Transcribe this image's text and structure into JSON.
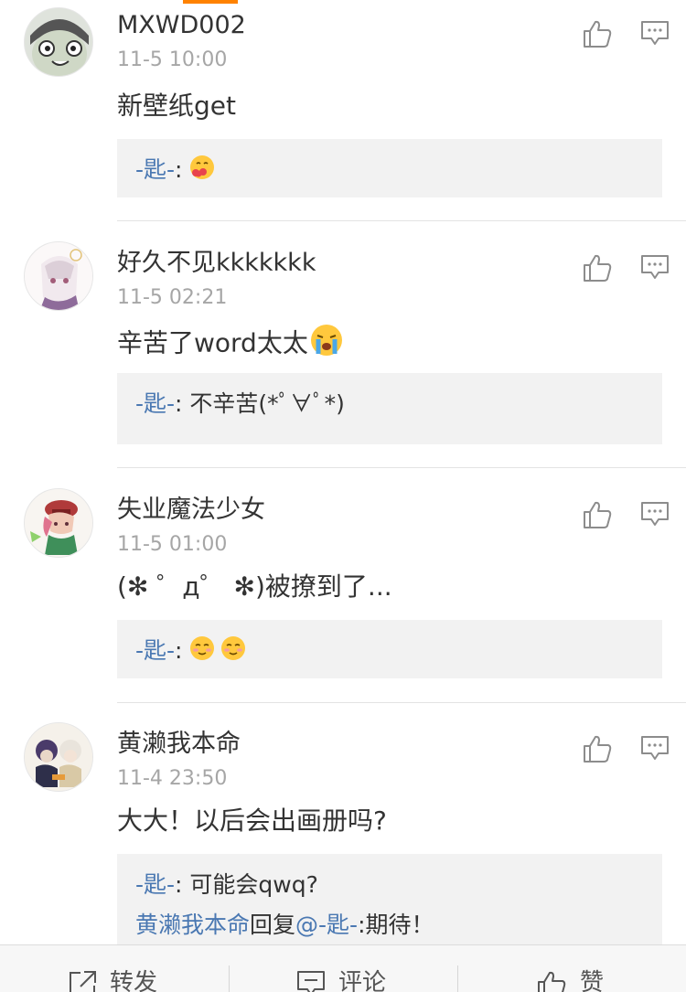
{
  "comments": [
    {
      "username": "MXWD002",
      "time": "11-5 10:00",
      "text": "新壁纸get",
      "text_emoji": "",
      "reply": {
        "author": "-匙-",
        "sep": ": ",
        "text": "",
        "emoji": [
          "tongue-kiss-emoji"
        ]
      }
    },
    {
      "username": "好久不见kkkkkkk",
      "time": "11-5 02:21",
      "text": "辛苦了word太太",
      "text_emoji": "crying-emoji",
      "reply": {
        "author": "-匙-",
        "sep": ": ",
        "text": "不辛苦(*ﾟ∀ﾟ*)",
        "emoji": []
      }
    },
    {
      "username": "失业魔法少女",
      "time": "11-5 01:00",
      "text": "(✻ ゜д゜ ✻)被撩到了...",
      "text_emoji": "",
      "reply": {
        "author": "-匙-",
        "sep": ": ",
        "text": "",
        "emoji": [
          "shy-smile-emoji",
          "shy-smile-emoji"
        ]
      }
    },
    {
      "username": "黄濑我本命",
      "time": "11-4 23:50",
      "text": "大大！以后会出画册吗?",
      "text_emoji": "",
      "reply": {
        "author": "-匙-",
        "sep": ": ",
        "text": "可能会qwq?",
        "emoji": []
      },
      "reply2": {
        "author": "黄濑我本命",
        "mid": "回复",
        "mention": "@-匙-",
        "text": ":期待！"
      }
    }
  ],
  "bottom_bar": {
    "repost": "转发",
    "comment": "评论",
    "like": "赞"
  },
  "colors": {
    "accent": "#ff8200",
    "link": "#4a78b2",
    "time": "#a6a6a6",
    "reply_bg": "#f2f2f2"
  }
}
